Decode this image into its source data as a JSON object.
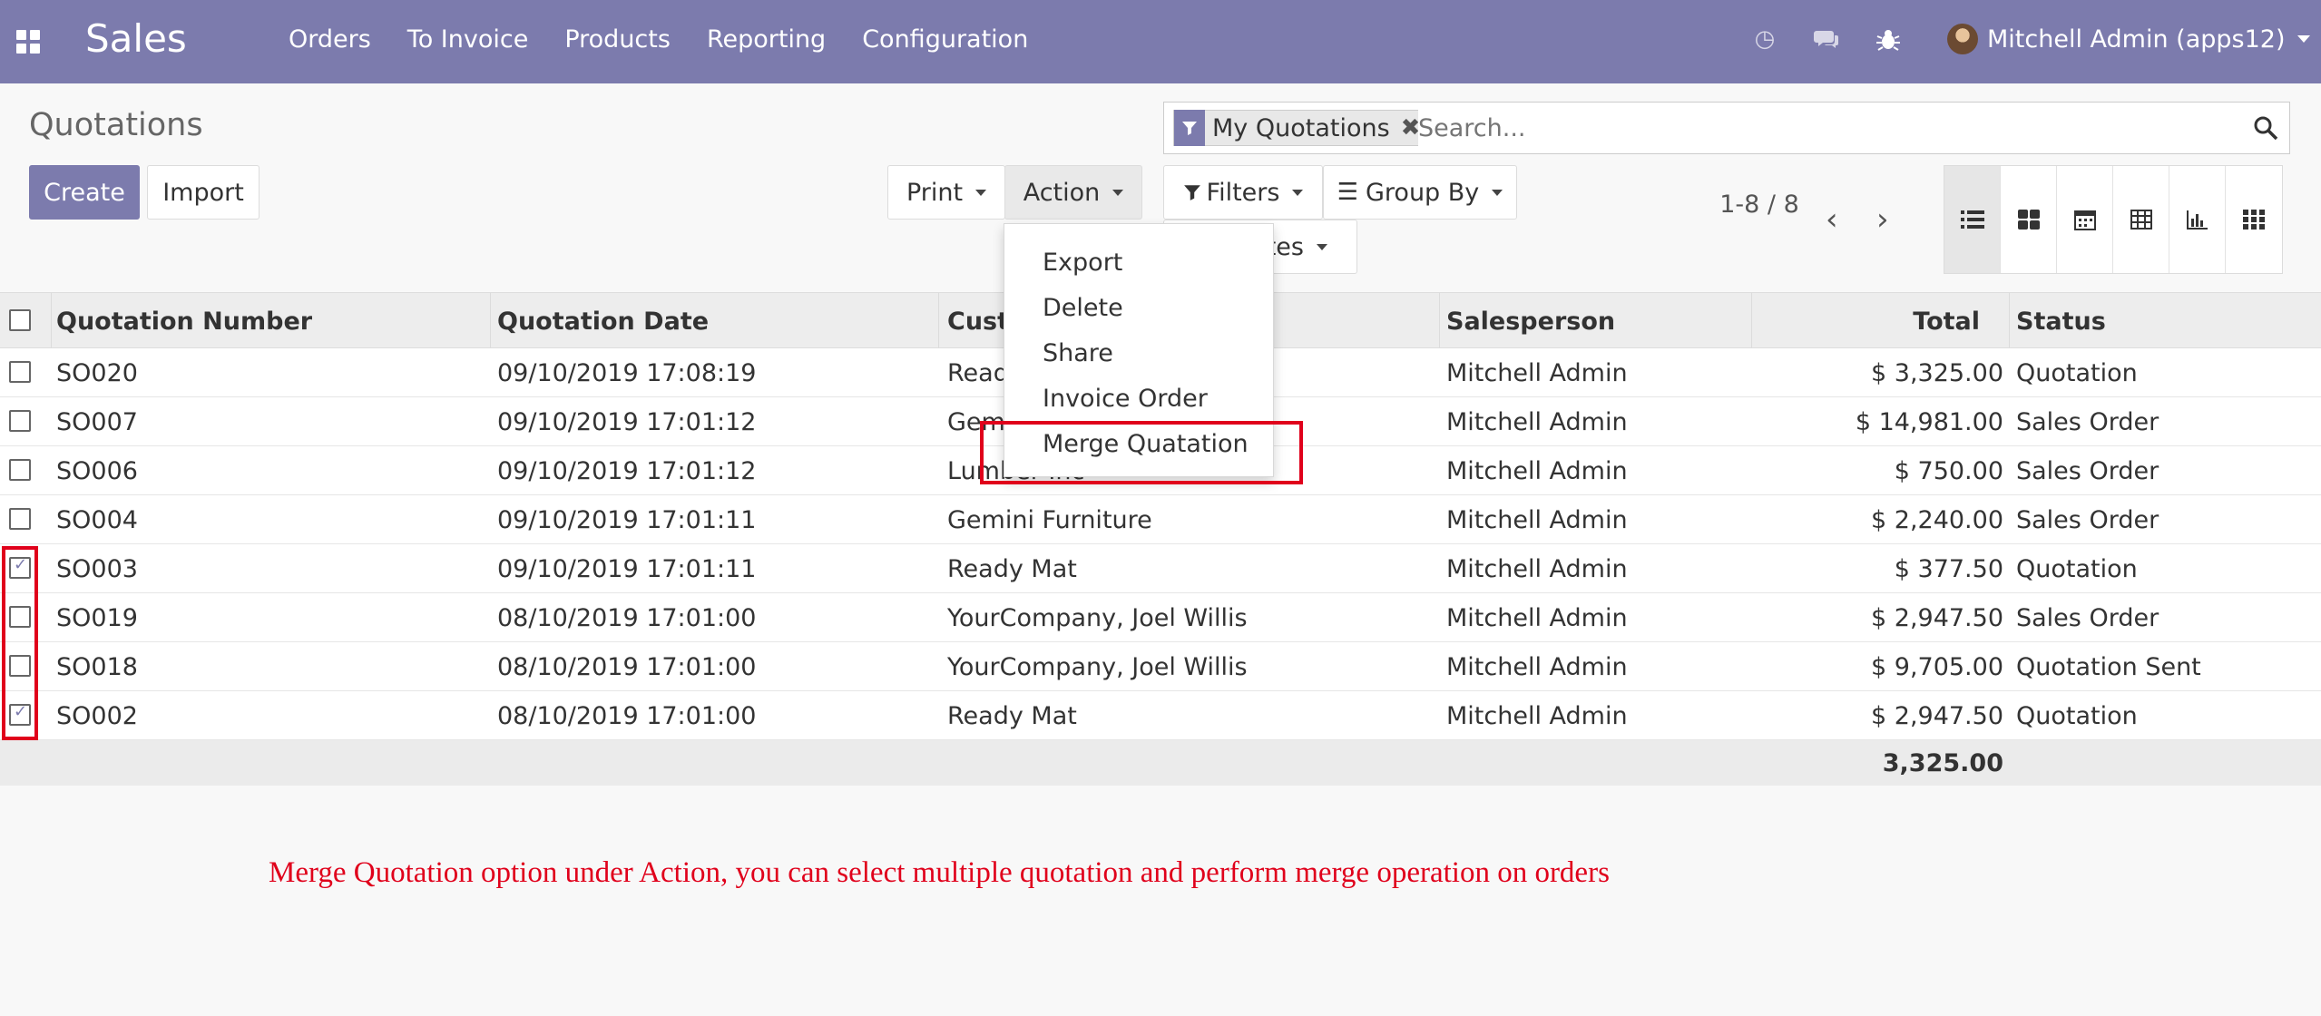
{
  "navbar": {
    "app_name": "Sales",
    "menu": [
      "Orders",
      "To Invoice",
      "Products",
      "Reporting",
      "Configuration"
    ],
    "user_name": "Mitchell Admin (apps12)",
    "icons": [
      "clock-icon",
      "chat-icon",
      "bug-icon"
    ]
  },
  "page": {
    "title": "Quotations",
    "create_label": "Create",
    "import_label": "Import",
    "print_label": "Print",
    "action_label": "Action",
    "filters_label": "Filters",
    "groupby_label": "Group By",
    "favorites_label": "Favorites",
    "search_placeholder": "Search...",
    "facet_label": "My Quotations",
    "pager_text": "1-8 / 8"
  },
  "action_menu": [
    "Export",
    "Delete",
    "Share",
    "Invoice Order",
    "Merge Quatation"
  ],
  "table": {
    "headers": [
      "Quotation Number",
      "Quotation Date",
      "Customer",
      "Salesperson",
      "Total",
      "Status"
    ],
    "rows": [
      {
        "checked": false,
        "number": "SO020",
        "date": "09/10/2019 17:08:19",
        "customer": "Ready Mat",
        "salesperson": "Mitchell Admin",
        "total": "$ 3,325.00",
        "status": "Quotation"
      },
      {
        "checked": false,
        "number": "SO007",
        "date": "09/10/2019 17:01:12",
        "customer": "Gemini Furniture",
        "salesperson": "Mitchell Admin",
        "total": "$ 14,981.00",
        "status": "Sales Order"
      },
      {
        "checked": false,
        "number": "SO006",
        "date": "09/10/2019 17:01:12",
        "customer": "Lumber Inc",
        "salesperson": "Mitchell Admin",
        "total": "$ 750.00",
        "status": "Sales Order"
      },
      {
        "checked": false,
        "number": "SO004",
        "date": "09/10/2019 17:01:11",
        "customer": "Gemini Furniture",
        "salesperson": "Mitchell Admin",
        "total": "$ 2,240.00",
        "status": "Sales Order"
      },
      {
        "checked": true,
        "number": "SO003",
        "date": "09/10/2019 17:01:11",
        "customer": "Ready Mat",
        "salesperson": "Mitchell Admin",
        "total": "$ 377.50",
        "status": "Quotation"
      },
      {
        "checked": false,
        "number": "SO019",
        "date": "08/10/2019 17:01:00",
        "customer": "YourCompany, Joel Willis",
        "salesperson": "Mitchell Admin",
        "total": "$ 2,947.50",
        "status": "Sales Order"
      },
      {
        "checked": false,
        "number": "SO018",
        "date": "08/10/2019 17:01:00",
        "customer": "YourCompany, Joel Willis",
        "salesperson": "Mitchell Admin",
        "total": "$ 9,705.00",
        "status": "Quotation Sent"
      },
      {
        "checked": true,
        "number": "SO002",
        "date": "08/10/2019 17:01:00",
        "customer": "Ready Mat",
        "salesperson": "Mitchell Admin",
        "total": "$ 2,947.50",
        "status": "Quotation"
      }
    ],
    "footer_total": "3,325.00"
  },
  "annotation": "Merge Quotation option under Action, you can select multiple quotation and perform merge operation on orders",
  "colors": {
    "brand": "#7c7bad",
    "highlight": "#e0001b"
  }
}
